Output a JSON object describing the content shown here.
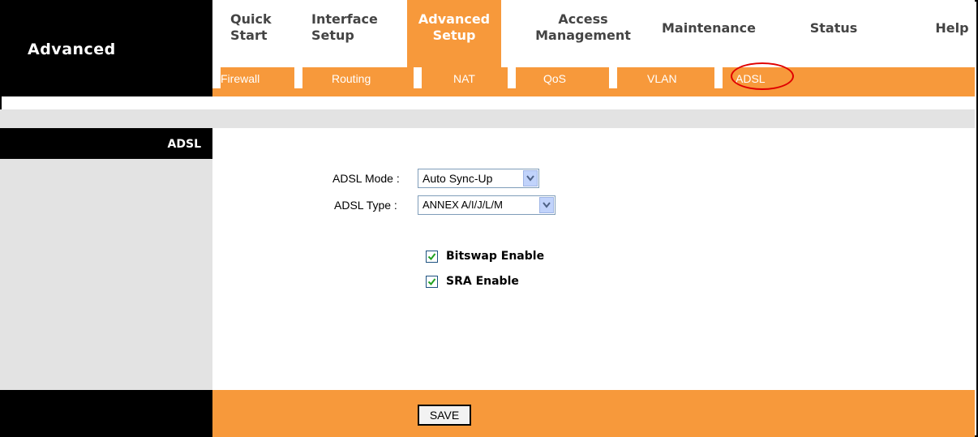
{
  "brand": "Advanced",
  "nav": {
    "items": [
      {
        "label": "Quick\nStart"
      },
      {
        "label": "Interface\nSetup"
      },
      {
        "label": "Advanced\nSetup",
        "active": true
      },
      {
        "label": "Access\nManagement"
      },
      {
        "label": "Maintenance"
      },
      {
        "label": "Status"
      },
      {
        "label": "Help"
      }
    ],
    "sub": [
      "Firewall",
      "Routing",
      "NAT",
      "QoS",
      "VLAN",
      "ADSL"
    ],
    "sub_active": "ADSL"
  },
  "sidebar": {
    "section": "ADSL"
  },
  "form": {
    "mode_label": "ADSL Mode :",
    "mode_value": "Auto Sync-Up",
    "type_label": "ADSL Type :",
    "type_value": "ANNEX A/I/J/L/M",
    "bitswap_label": "Bitswap Enable",
    "bitswap_checked": true,
    "sra_label": "SRA Enable",
    "sra_checked": true
  },
  "footer": {
    "save_label": "SAVE"
  },
  "colors": {
    "accent": "#F7993B",
    "dark": "#000000",
    "panel": "#E3E3E3",
    "highlight": "#E00000"
  }
}
